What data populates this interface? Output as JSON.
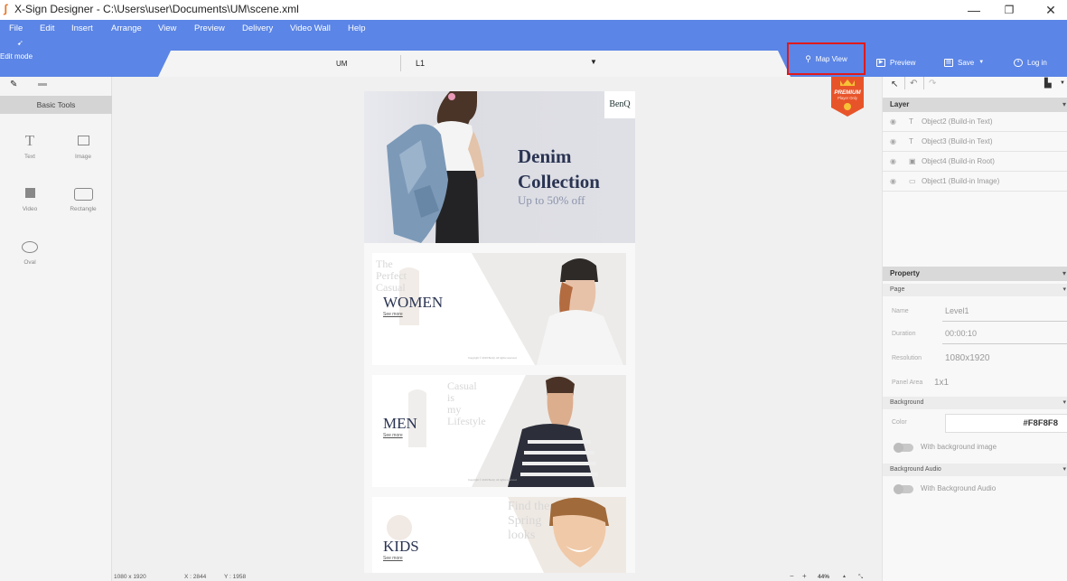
{
  "window": {
    "title": "X-Sign Designer - C:\\Users\\user\\Documents\\UM\\scene.xml",
    "controls": [
      "—",
      "❐",
      "✕"
    ]
  },
  "menu": [
    "File",
    "Edit",
    "Insert",
    "Arrange",
    "View",
    "Preview",
    "Delivery",
    "Video Wall",
    "Help"
  ],
  "toolbar": {
    "edit_mode": "Edit mode",
    "doc_name": "UM",
    "level": "L1",
    "map_view": "Map View",
    "preview": "Preview",
    "save": "Save",
    "login": "Log in"
  },
  "tools": {
    "header": "Basic Tools",
    "items": [
      "Text",
      "Image",
      "Video",
      "Rectangle",
      "Oval"
    ]
  },
  "artboard": {
    "brand": "BenQ",
    "hero_title_1": "Denim",
    "hero_title_2": "Collection",
    "hero_sub": "Up to 50% off",
    "women": {
      "ghost": [
        "The",
        "Perfect",
        "Casual"
      ],
      "label": "WOMEN",
      "see": "See more"
    },
    "men": {
      "ghost": [
        "Casual",
        "is",
        "my",
        "Lifestyle"
      ],
      "label": "MEN",
      "see": "See more"
    },
    "kids": {
      "ghost": [
        "Find the",
        "Spring",
        "looks"
      ],
      "label": "KIDS",
      "see": "See more"
    },
    "copyright": "Copyright © 2019 BenQ. All rights reserved."
  },
  "premium": {
    "line1": "PREMIUM",
    "line2": "Player Only"
  },
  "layers": {
    "header": "Layer",
    "items": [
      {
        "icon": "T",
        "name": "Object2 (Build-in Text)"
      },
      {
        "icon": "T",
        "name": "Object3 (Build-in Text)"
      },
      {
        "icon": "▣",
        "name": "Object4 (Build-in Root)"
      },
      {
        "icon": "▭",
        "name": "Object1 (Build-in Image)"
      }
    ]
  },
  "property": {
    "header": "Property",
    "page_section": "Page",
    "rows": [
      {
        "key": "Name",
        "value": "Level1"
      },
      {
        "key": "Duration",
        "value": "00:00:10"
      },
      {
        "key": "Resolution",
        "value": "1080x1920"
      },
      {
        "key": "Panel Area",
        "value": "1x1"
      }
    ],
    "background_section": "Background",
    "color_label": "Color",
    "color_value": "#F8F8F8",
    "with_bg_image": "With background image",
    "audio_section": "Background Audio",
    "with_bg_audio": "With Background Audio"
  },
  "status": {
    "size": "1080 x 1920",
    "x": "X : 2844",
    "y": "Y : 1958",
    "zoom": "44%"
  },
  "colors": {
    "accent": "#5b85e6",
    "highlight": "#e01a1a"
  }
}
